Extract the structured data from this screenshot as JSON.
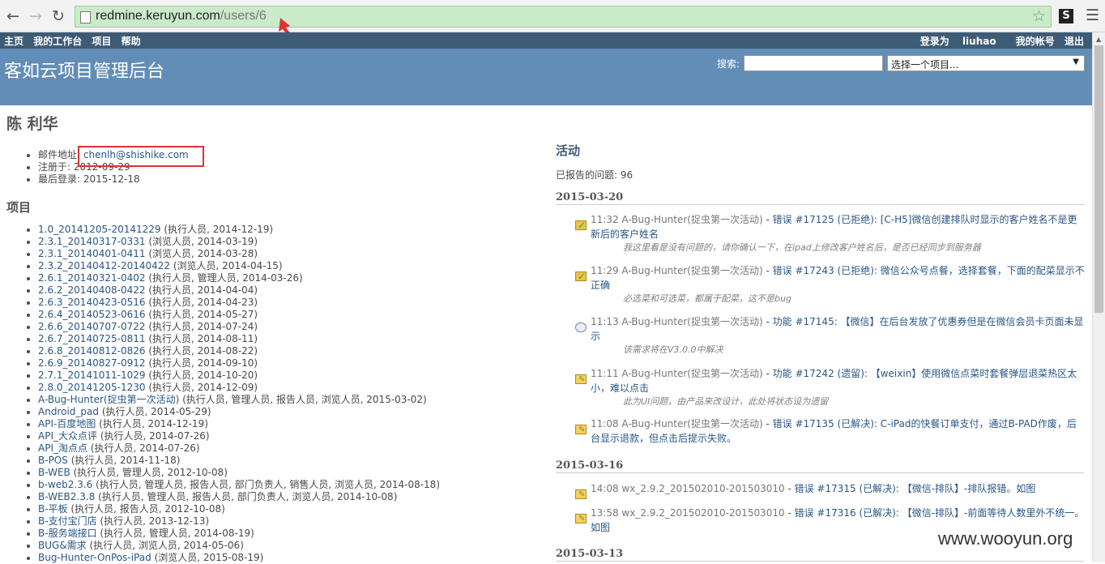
{
  "browser": {
    "back_icon": "←",
    "forward_icon": "→",
    "reload_icon": "↻",
    "url_host": "redmine.keruyun.com",
    "url_path": "/users/6",
    "star_icon": "☆",
    "ext_label": "S",
    "menu_icon": "☰"
  },
  "top_menu": {
    "left": [
      "主页",
      "我的工作台",
      "项目",
      "帮助"
    ],
    "logged_in_as": "登录为",
    "username": "liuhao",
    "my_account": "我的帐号",
    "logout": "退出"
  },
  "header": {
    "title": "客如云项目管理后台",
    "search_label": "搜索:",
    "project_select": "选择一个项目..."
  },
  "user": {
    "name": "陈 利华",
    "info": [
      {
        "label": "邮件地址:",
        "value": "chenlh@shishike.com"
      },
      {
        "label": "注册于:",
        "value": "2012-09-29"
      },
      {
        "label": "最后登录:",
        "value": "2015-12-18"
      }
    ]
  },
  "projects": {
    "heading": "项目",
    "items": [
      {
        "name": "1.0_20141205-20141229",
        "roles": "(执行人员, 2014-12-19)"
      },
      {
        "name": "2.3.1_20140317-0331",
        "roles": "(浏览人员, 2014-03-19)"
      },
      {
        "name": "2.3.1_20140401-0411",
        "roles": "(浏览人员, 2014-03-28)"
      },
      {
        "name": "2.3.2_20140412-20140422",
        "roles": "(浏览人员, 2014-04-15)"
      },
      {
        "name": "2.6.1_20140321-0402",
        "roles": "(执行人员, 管理人员, 2014-03-26)"
      },
      {
        "name": "2.6.2_20140408-0422",
        "roles": "(执行人员, 2014-04-04)"
      },
      {
        "name": "2.6.3_20140423-0516",
        "roles": "(执行人员, 2014-04-23)"
      },
      {
        "name": "2.6.4_20140523-0616",
        "roles": "(执行人员, 2014-05-27)"
      },
      {
        "name": "2.6.6_20140707-0722",
        "roles": "(执行人员, 2014-07-24)"
      },
      {
        "name": "2.6.7_20140725-0811",
        "roles": "(执行人员, 2014-08-11)"
      },
      {
        "name": "2.6.8_20140812-0826",
        "roles": "(执行人员, 2014-08-22)"
      },
      {
        "name": "2.6.9_20140827-0912",
        "roles": "(执行人员, 2014-09-10)"
      },
      {
        "name": "2.7.1_20141011-1029",
        "roles": "(执行人员, 2014-10-20)"
      },
      {
        "name": "2.8.0_20141205-1230",
        "roles": "(执行人员, 2014-12-09)"
      },
      {
        "name": "A-Bug-Hunter(捉虫第一次活动)",
        "roles": "(执行人员, 管理人员, 报告人员, 浏览人员, 2015-03-02)"
      },
      {
        "name": "Android_pad",
        "roles": "(执行人员, 2014-05-29)"
      },
      {
        "name": "API-百度地图",
        "roles": "(执行人员, 2014-12-19)"
      },
      {
        "name": "API_大众点评",
        "roles": "(执行人员, 2014-07-26)"
      },
      {
        "name": "API_淘点点",
        "roles": "(执行人员, 2014-07-26)"
      },
      {
        "name": "B-POS",
        "roles": "(执行人员, 2014-11-18)"
      },
      {
        "name": "B-WEB",
        "roles": "(执行人员, 管理人员, 2012-10-08)"
      },
      {
        "name": "b-web2.3.6",
        "roles": "(执行人员, 管理人员, 报告人员, 部门负责人, 销售人员, 浏览人员, 2014-08-18)"
      },
      {
        "name": "B-WEB2.3.8",
        "roles": "(执行人员, 管理人员, 报告人员, 部门负责人, 浏览人员, 2014-10-08)"
      },
      {
        "name": "B-平板",
        "roles": "(执行人员, 报告人员, 2012-10-08)"
      },
      {
        "name": "B-支付宝门店",
        "roles": "(执行人员, 2013-12-13)"
      },
      {
        "name": "B-服务端接口",
        "roles": "(执行人员, 管理人员, 2014-08-19)"
      },
      {
        "name": "BUG&需求",
        "roles": "(执行人员, 浏览人员, 2014-05-06)"
      },
      {
        "name": "Bug-Hunter-OnPos-iPad",
        "roles": "(浏览人员, 2015-08-19)"
      }
    ]
  },
  "activity": {
    "heading": "活动",
    "reported": "已报告的问题: 96",
    "days": [
      {
        "date": "2015-03-20",
        "events": [
          {
            "icon": "bug-closed-icon",
            "time": "11:32",
            "project": "A-Bug-Hunter(捉虫第一次活动)",
            "sep": " - ",
            "link": "错误 #17125 (已拒绝): [C-H5]微信创建排队时显示的客户姓名不是更新后的客户姓名",
            "desc": "我这里看是没有问题的，请你确认一下，在ipad上修改客户姓名后，是否已经同步到服务器"
          },
          {
            "icon": "bug-closed-icon",
            "time": "11:29",
            "project": "A-Bug-Hunter(捉虫第一次活动)",
            "sep": " - ",
            "link": "错误 #17243 (已拒绝): 微信公众号点餐，选择套餐，下面的配菜显示不正确",
            "desc": "必选菜和可选菜，都属于配菜，这不是bug"
          },
          {
            "icon": "note-icon",
            "time": "11:13",
            "project": "A-Bug-Hunter(捉虫第一次活动)",
            "sep": " - ",
            "link": "功能 #17145: 【微信】在后台发放了优惠券但是在微信会员卡页面未显示",
            "desc": "该需求将在V3.0.0中解决"
          },
          {
            "icon": "edit-icon",
            "time": "11:11",
            "project": "A-Bug-Hunter(捉虫第一次活动)",
            "sep": " - ",
            "link": "功能 #17242 (遗留): 【weixin】使用微信点菜时套餐弹层退菜热区太小，难以点击",
            "desc": "此为UI问题，由产品来改设计，此处将状态设为遗留"
          },
          {
            "icon": "edit-icon",
            "time": "11:08",
            "project": "A-Bug-Hunter(捉虫第一次活动)",
            "sep": " - ",
            "link": "错误 #17135 (已解决): C-iPad的快餐订单支付，通过B-PAD作废，后台显示退款，但点击后提示失败。",
            "desc": ""
          }
        ]
      },
      {
        "date": "2015-03-16",
        "events": [
          {
            "icon": "edit-icon",
            "time": "14:08",
            "project": "wx_2.9.2_201502010-201503010",
            "sep": " - ",
            "link": "错误 #17315 (已解决): 【微信-排队】-排队报错。如图",
            "desc": ""
          },
          {
            "icon": "edit-icon",
            "time": "13:58",
            "project": "wx_2.9.2_201502010-201503010",
            "sep": " - ",
            "link": "错误 #17316 (已解决): 【微信-排队】-前面等待人数里外不统一。如图",
            "desc": ""
          }
        ]
      },
      {
        "date": "2015-03-13",
        "events": []
      }
    ]
  },
  "watermark": "www.wooyun.org",
  "colors": {
    "top_menu": "#3e5b76",
    "header": "#628db6",
    "url_bar": "#c9ebc9",
    "annotation": "#dd3333",
    "link": "#2a5685"
  }
}
